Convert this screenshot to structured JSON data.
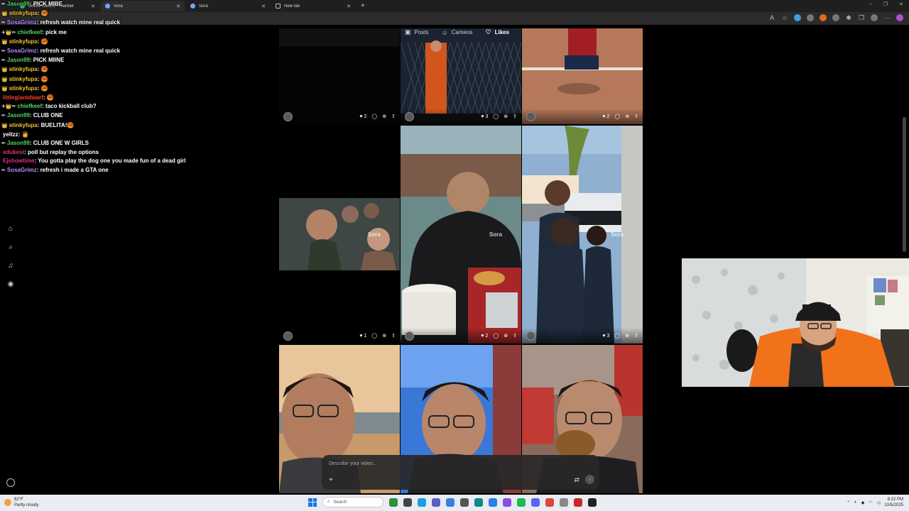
{
  "browser": {
    "tabs": [
      {
        "label": "Online Casino - Rainbet",
        "active": false
      },
      {
        "label": "Sora",
        "active": true
      },
      {
        "label": "Sora",
        "active": false
      },
      {
        "label": "New tab",
        "active": false
      }
    ],
    "new_tab_glyph": "+",
    "window_controls": [
      "–",
      "❐",
      "✕"
    ]
  },
  "chat": [
    {
      "badges": "✏",
      "user": "Jason99",
      "color": "#4cd964",
      "msg": "PICK MIBE"
    },
    {
      "badges": "👑",
      "user": "stinkyfupa",
      "color": "#f1c232",
      "msg": "🥮"
    },
    {
      "badges": "✏",
      "user": "SosaGrimz",
      "color": "#b38cff",
      "msg": "refresh watch mine real quick"
    },
    {
      "badges": "✈👑✏",
      "user": "chiefkeef",
      "color": "#4cd964",
      "msg": "pick me"
    },
    {
      "badges": "👑",
      "user": "stinkyfupa",
      "color": "#f1c232",
      "msg": "🥮"
    },
    {
      "badges": "✏",
      "user": "SosaGrimz",
      "color": "#b38cff",
      "msg": "refresh watch mine real quick"
    },
    {
      "badges": "✏",
      "user": "Jason99",
      "color": "#4cd964",
      "msg": "PICK MIINE"
    },
    {
      "badges": "👑",
      "user": "stinkyfupa",
      "color": "#f1c232",
      "msg": "🥮"
    },
    {
      "badges": "👑",
      "user": "stinkyfupa",
      "color": "#f1c232",
      "msg": "🥮"
    },
    {
      "badges": "👑",
      "user": "stinkyfupa",
      "color": "#f1c232",
      "msg": "🥮"
    },
    {
      "badges": "",
      "user": "littlegiantdwarf",
      "color": "#ff3b30",
      "msg": "🥮"
    },
    {
      "badges": "✈👑✏",
      "user": "chiefkeef",
      "color": "#4cd964",
      "msg": "taco kickball club?"
    },
    {
      "badges": "✏",
      "user": "Jason99",
      "color": "#4cd964",
      "msg": "CLUB ONE"
    },
    {
      "badges": "👑",
      "user": "stinkyfupa",
      "color": "#f1c232",
      "msg": "BUELITA!🥮"
    },
    {
      "badges": "",
      "user": "yeltzz",
      "color": "#ffffff",
      "msg": "👩"
    },
    {
      "badges": "✏",
      "user": "Jason99",
      "color": "#4cd964",
      "msg": "CLUB ONE W GIRLS"
    },
    {
      "badges": "",
      "user": "edukest",
      "color": "#e0337a",
      "msg": "poll but replay the options"
    },
    {
      "badges": "",
      "user": "Ejshowtime",
      "color": "#e0337a",
      "msg": "You gotta play the dog one you made fun of a dead girl"
    },
    {
      "badges": "✏",
      "user": "SosaGrimz",
      "color": "#b38cff",
      "msg": "refresh i made a GTA one"
    }
  ],
  "sora_nav": {
    "posts": "Posts",
    "cameos": "Cameos",
    "likes": "Likes"
  },
  "grid": {
    "watermark": "Sora",
    "cells": [
      {
        "likes": "2",
        "has_stats": true,
        "has_watermark": false
      },
      {
        "likes": "3",
        "has_stats": true,
        "has_watermark": false
      },
      {
        "likes": "2",
        "has_stats": true,
        "has_watermark": false
      },
      {
        "likes": "1",
        "has_stats": true,
        "has_watermark": true
      },
      {
        "likes": "2",
        "has_stats": true,
        "has_watermark": true
      },
      {
        "likes": "3",
        "has_stats": true,
        "has_watermark": true
      },
      {
        "likes": "",
        "has_stats": false,
        "has_watermark": false
      },
      {
        "likes": "",
        "has_stats": false,
        "has_watermark": false
      },
      {
        "likes": "",
        "has_stats": false,
        "has_watermark": false
      }
    ]
  },
  "prompt": {
    "placeholder": "Describe your video...",
    "plus": "+",
    "settings_glyph": "⇄",
    "send_glyph": "↑"
  },
  "taskbar": {
    "weather_temp": "82°F",
    "weather_desc": "Partly cloudy",
    "search_label": "Search",
    "time": "8:22 PM",
    "date": "10/5/2025"
  },
  "colors": {
    "background": "#000000",
    "tab_bar": "#1f1f1f",
    "taskbar": "#e9ecf2",
    "accent_orange": "#e26a1c"
  }
}
